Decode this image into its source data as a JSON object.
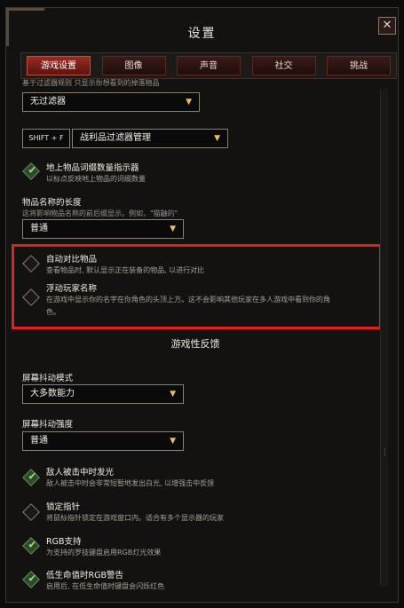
{
  "window": {
    "title": "设置",
    "close_label": "✕"
  },
  "tabs": [
    {
      "label": "游戏设置",
      "active": true
    },
    {
      "label": "图像",
      "active": false
    },
    {
      "label": "声音",
      "active": false
    },
    {
      "label": "社交",
      "active": false
    },
    {
      "label": "挑战",
      "active": false
    }
  ],
  "top_hint": "基于过滤器规则 只显示你想看到的掉落物品",
  "filter": {
    "value": "无过滤器",
    "shortcut": "SHIFT + F",
    "manager": "战利品过滤器管理"
  },
  "affix_indicator": {
    "title": "地上物品词缀数量指示器",
    "desc": "以标点反映地上物品的词缀数量",
    "checked": true
  },
  "name_length": {
    "label": "物品名称的长度",
    "desc": "这将影响物品名称的前后缀显示。例如，\"猫鼬的\"",
    "value": "普通"
  },
  "auto_compare": {
    "title": "自动对比物品",
    "desc": "查看物品时, 默认显示正在装备的物品, 以进行对比",
    "checked": false
  },
  "floating_names": {
    "title": "浮动玩家名称",
    "desc_line1": "在游戏中显示你的名字在你角色的头顶上方。这不会影响其他玩家在多人游戏中看到你的角",
    "desc_line2": "色。",
    "checked": false
  },
  "feedback_header": "游戏性反馈",
  "shake_mode": {
    "label": "屏幕抖动模式",
    "value": "大多数能力"
  },
  "shake_strength": {
    "label": "屏幕抖动强度",
    "value": "普通"
  },
  "enemy_flash": {
    "title": "敌人被击中时发光",
    "desc": "敌人被击中时会非常短暂地发出白光, 以增强击中反馈",
    "checked": true
  },
  "lock_cursor": {
    "title": "锁定指针",
    "desc": "将鼠标指针锁定在游戏窗口内。适合有多个显示器的玩家",
    "checked": false
  },
  "rgb_support": {
    "title": "RGB支持",
    "desc": "为支持的罗技键盘启用RGB灯光效果",
    "checked": true
  },
  "low_health_rgb": {
    "title": "低生命值时RGB警告",
    "desc": "启用后, 在低生命值时键盘会闪烁红色",
    "checked": true
  },
  "colors": {
    "accent_red": "#e0201c",
    "active_tab": "#9a2a22",
    "check_green": "#8fe070"
  }
}
